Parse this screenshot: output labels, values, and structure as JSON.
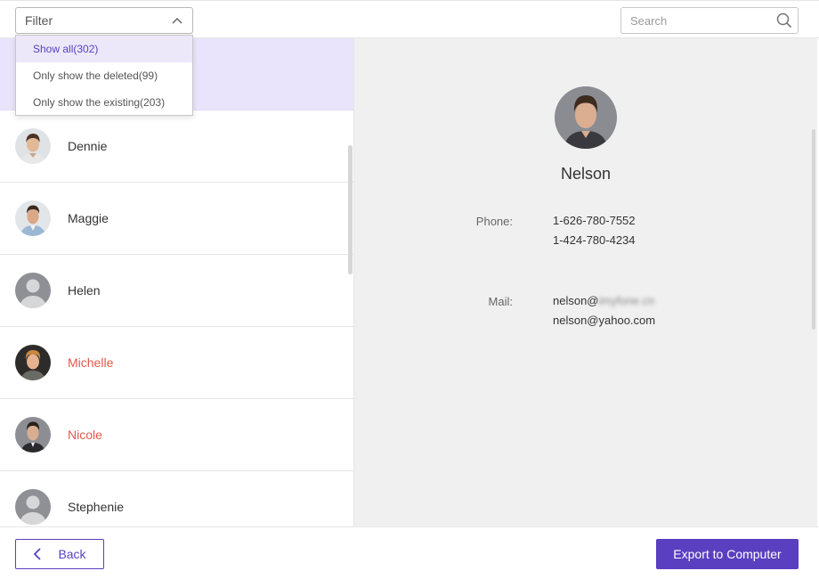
{
  "filter": {
    "label": "Filter",
    "options": [
      {
        "label": "Show all(302)",
        "active": true
      },
      {
        "label": "Only show the deleted(99)",
        "active": false
      },
      {
        "label": "Only show the existing(203)",
        "active": false
      }
    ]
  },
  "search": {
    "placeholder": "Search",
    "value": ""
  },
  "contacts": [
    {
      "name": "",
      "deleted": false,
      "selected": true,
      "avatar": "photo-man-icon"
    },
    {
      "name": "Dennie",
      "deleted": false,
      "selected": false,
      "avatar": "photo-man-icon"
    },
    {
      "name": "Maggie",
      "deleted": false,
      "selected": false,
      "avatar": "photo-man-icon"
    },
    {
      "name": "Helen",
      "deleted": false,
      "selected": false,
      "avatar": "default-person-icon"
    },
    {
      "name": "Michelle",
      "deleted": true,
      "selected": false,
      "avatar": "photo-man-icon"
    },
    {
      "name": "Nicole",
      "deleted": true,
      "selected": false,
      "avatar": "photo-man-icon"
    },
    {
      "name": "Stephenie",
      "deleted": false,
      "selected": false,
      "avatar": "default-person-icon"
    }
  ],
  "detail": {
    "name": "Nelson",
    "phone_label": "Phone:",
    "phones": [
      "1-626-780-7552",
      "1-424-780-4234"
    ],
    "mail_label": "Mail:",
    "mail_1_visible": "nelson@",
    "mail_1_blurred": "imyfone.cn",
    "mail_2": "nelson@yahoo.com"
  },
  "footer": {
    "back_label": "Back",
    "export_label": "Export to Computer"
  },
  "colors": {
    "accent": "#5a3fc0",
    "deleted": "#e0584a",
    "selected_bg": "#e9e4fb"
  }
}
